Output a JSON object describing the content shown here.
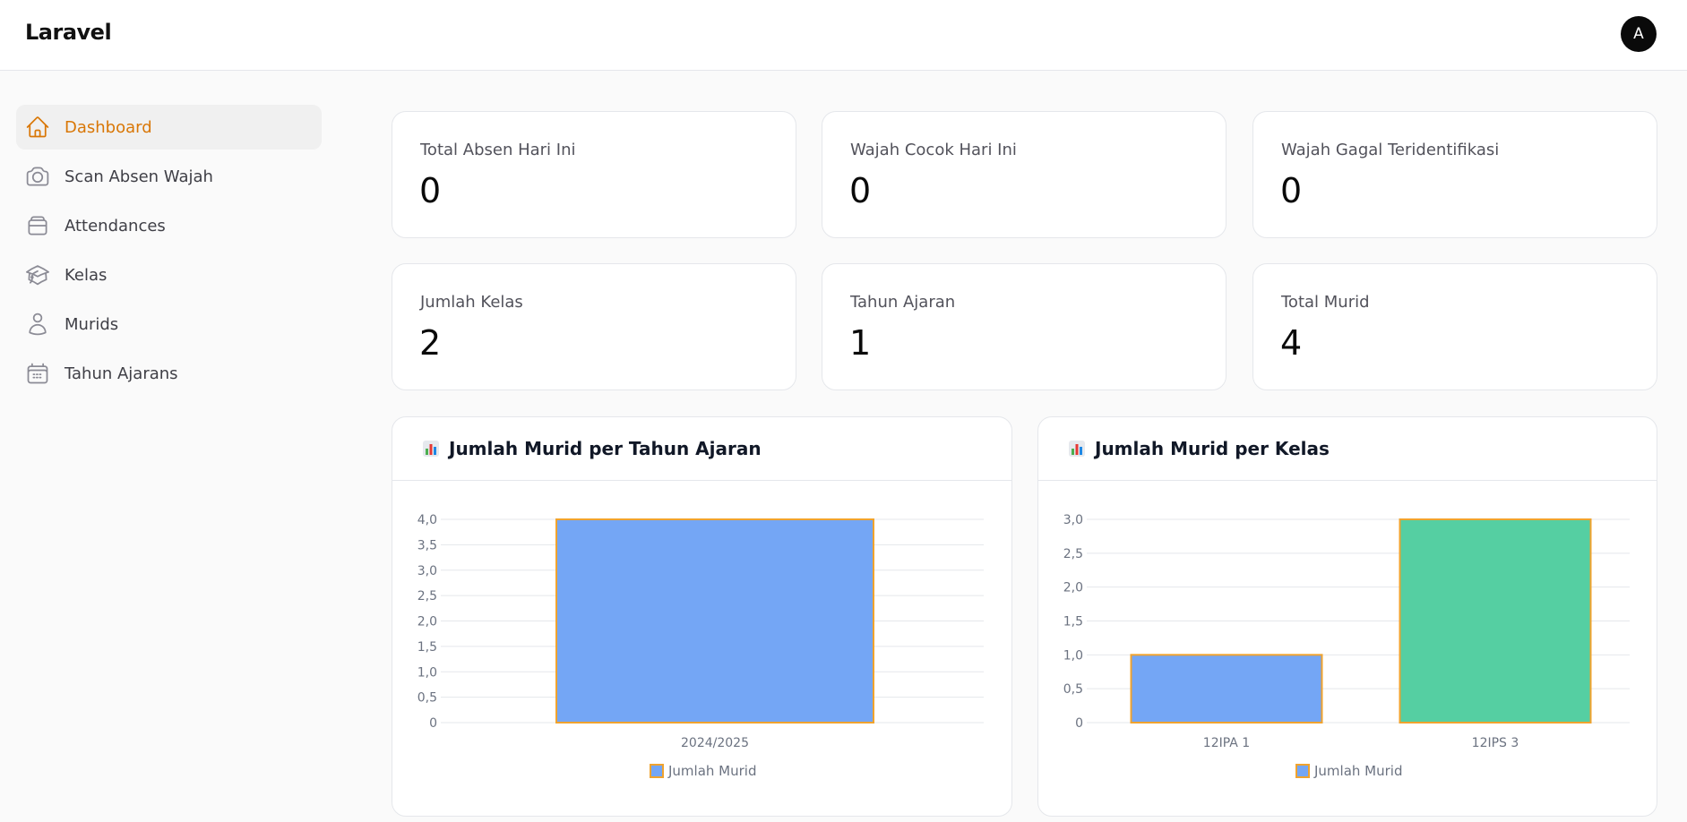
{
  "header": {
    "brand": "Laravel",
    "avatar_initial": "A"
  },
  "sidebar": {
    "items": [
      {
        "label": "Dashboard",
        "icon": "home-icon",
        "active": true
      },
      {
        "label": "Scan Absen Wajah",
        "icon": "camera-icon",
        "active": false
      },
      {
        "label": "Attendances",
        "icon": "archive-box-icon",
        "active": false
      },
      {
        "label": "Kelas",
        "icon": "academic-cap-icon",
        "active": false
      },
      {
        "label": "Murids",
        "icon": "user-icon",
        "active": false
      },
      {
        "label": "Tahun Ajarans",
        "icon": "calendar-icon",
        "active": false
      }
    ]
  },
  "stats": [
    {
      "label": "Total Absen Hari Ini",
      "value": "0"
    },
    {
      "label": "Wajah Cocok Hari Ini",
      "value": "0"
    },
    {
      "label": "Wajah Gagal Teridentifikasi",
      "value": "0"
    },
    {
      "label": "Jumlah Kelas",
      "value": "2"
    },
    {
      "label": "Tahun Ajaran",
      "value": "1"
    },
    {
      "label": "Total Murid",
      "value": "4"
    }
  ],
  "colors": {
    "accent": "#d97706",
    "bar_blue": "#74a6f5",
    "bar_green": "#55cfa2",
    "bar_border": "#f0a32e",
    "grid": "#e5e7eb"
  },
  "charts": [
    {
      "title": "Jumlah Murid per Tahun Ajaran",
      "icon": "bar-chart-emoji-icon"
    },
    {
      "title": "Jumlah Murid per Kelas",
      "icon": "bar-chart-emoji-icon"
    }
  ],
  "chart_data": [
    {
      "type": "bar",
      "categories": [
        "2024/2025"
      ],
      "series": [
        {
          "name": "Jumlah Murid",
          "values": [
            4
          ]
        }
      ],
      "bar_colors": [
        "#74a6f5"
      ],
      "ylim": [
        0,
        4
      ],
      "yticks": [
        "0",
        "0,5",
        "1,0",
        "1,5",
        "2,0",
        "2,5",
        "3,0",
        "3,5",
        "4,0"
      ],
      "legend": "bottom",
      "grid": true
    },
    {
      "type": "bar",
      "categories": [
        "12IPA 1",
        "12IPS 3"
      ],
      "series": [
        {
          "name": "Jumlah Murid",
          "values": [
            1,
            3
          ]
        }
      ],
      "bar_colors": [
        "#74a6f5",
        "#55cfa2"
      ],
      "ylim": [
        0,
        3
      ],
      "yticks": [
        "0",
        "0,5",
        "1,0",
        "1,5",
        "2,0",
        "2,5",
        "3,0"
      ],
      "legend": "bottom",
      "grid": true
    }
  ]
}
